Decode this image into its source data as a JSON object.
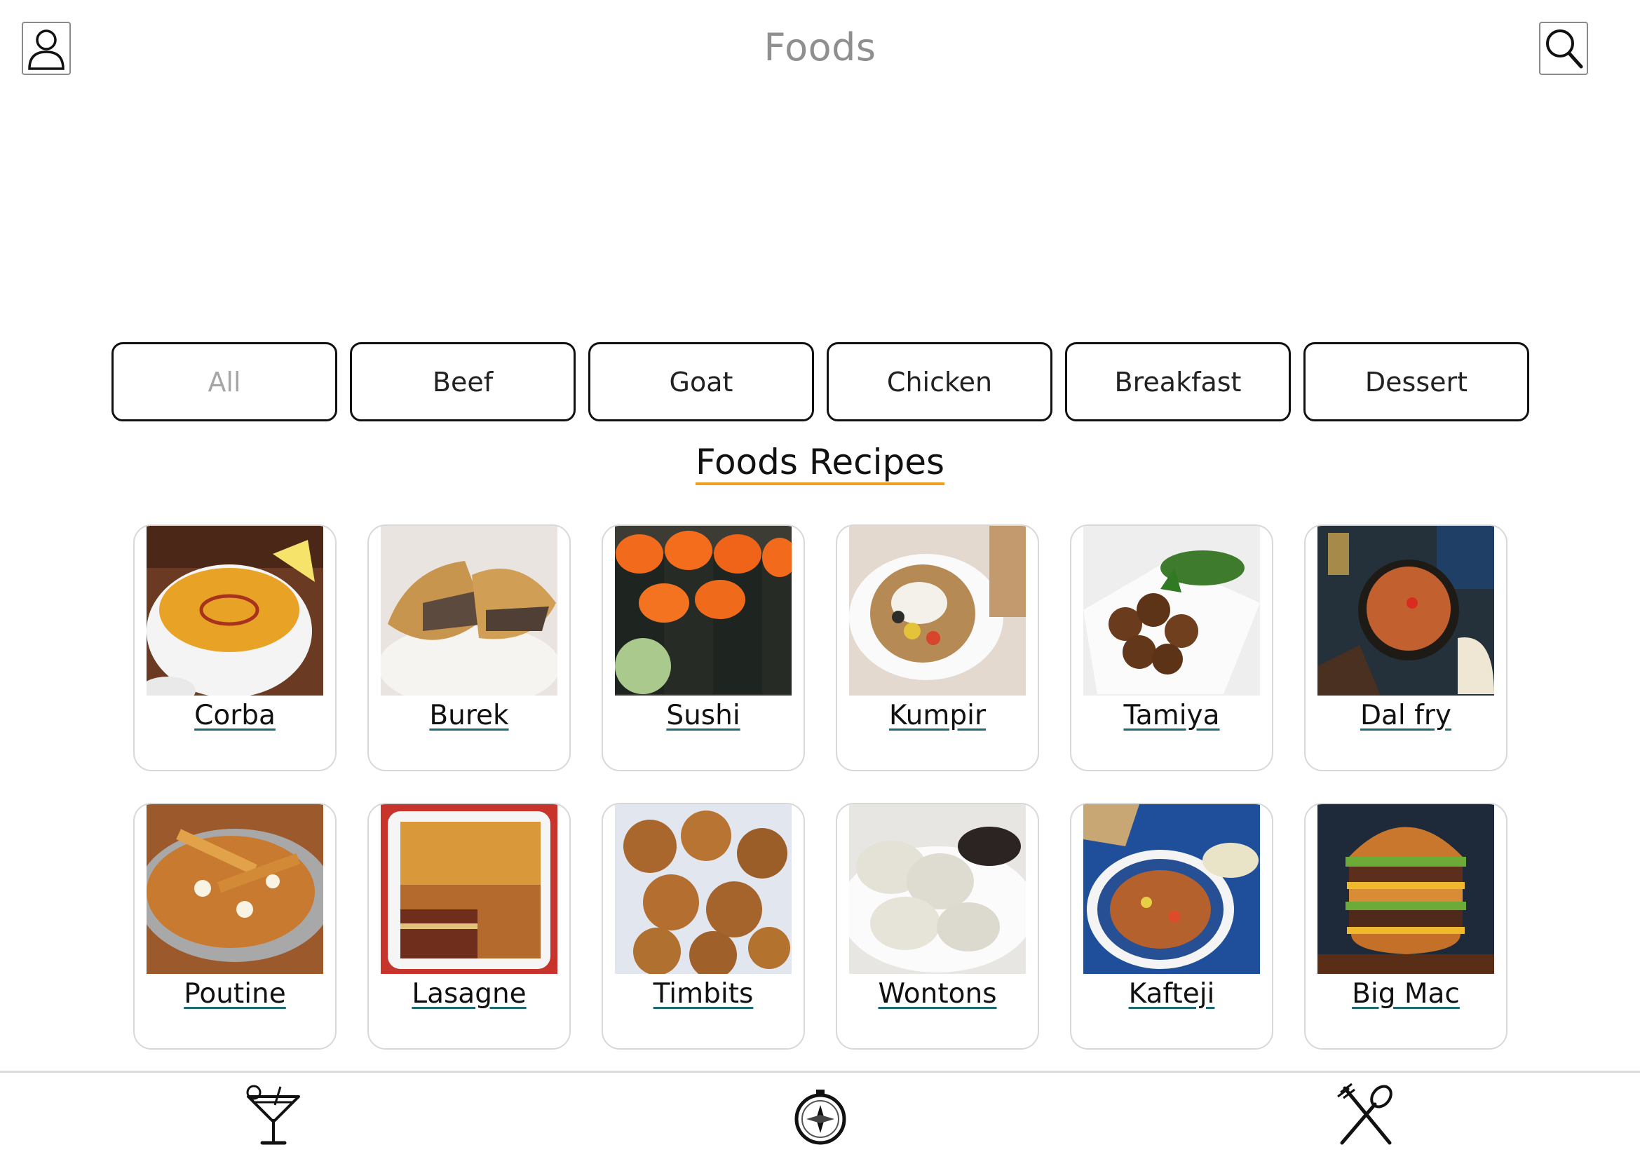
{
  "header": {
    "title": "Foods",
    "left_icon": "user-icon",
    "right_icon": "search-icon"
  },
  "filters": [
    {
      "label": "All",
      "active": true
    },
    {
      "label": "Beef",
      "active": false
    },
    {
      "label": "Goat",
      "active": false
    },
    {
      "label": "Chicken",
      "active": false
    },
    {
      "label": "Breakfast",
      "active": false
    },
    {
      "label": "Dessert",
      "active": false
    }
  ],
  "section": {
    "title": "Foods Recipes",
    "accent_color": "#f0a020"
  },
  "recipes": [
    {
      "name": "Corba",
      "image": "lentil-soup-photo"
    },
    {
      "name": "Burek",
      "image": "meat-pastry-photo"
    },
    {
      "name": "Sushi",
      "image": "sushi-rolls-photo"
    },
    {
      "name": "Kumpir",
      "image": "stuffed-potato-photo"
    },
    {
      "name": "Tamiya",
      "image": "falafel-photo"
    },
    {
      "name": "Dal fry",
      "image": "lentil-curry-photo"
    },
    {
      "name": "Poutine",
      "image": "fries-gravy-photo"
    },
    {
      "name": "Lasagne",
      "image": "lasagne-photo"
    },
    {
      "name": "Timbits",
      "image": "donut-holes-photo"
    },
    {
      "name": "Wontons",
      "image": "dumplings-photo"
    },
    {
      "name": "Kafteji",
      "image": "vegetable-stew-photo"
    },
    {
      "name": "Big Mac",
      "image": "burger-photo"
    }
  ],
  "bottom_nav": [
    {
      "icon": "cocktail-icon"
    },
    {
      "icon": "compass-icon"
    },
    {
      "icon": "utensils-icon"
    }
  ]
}
